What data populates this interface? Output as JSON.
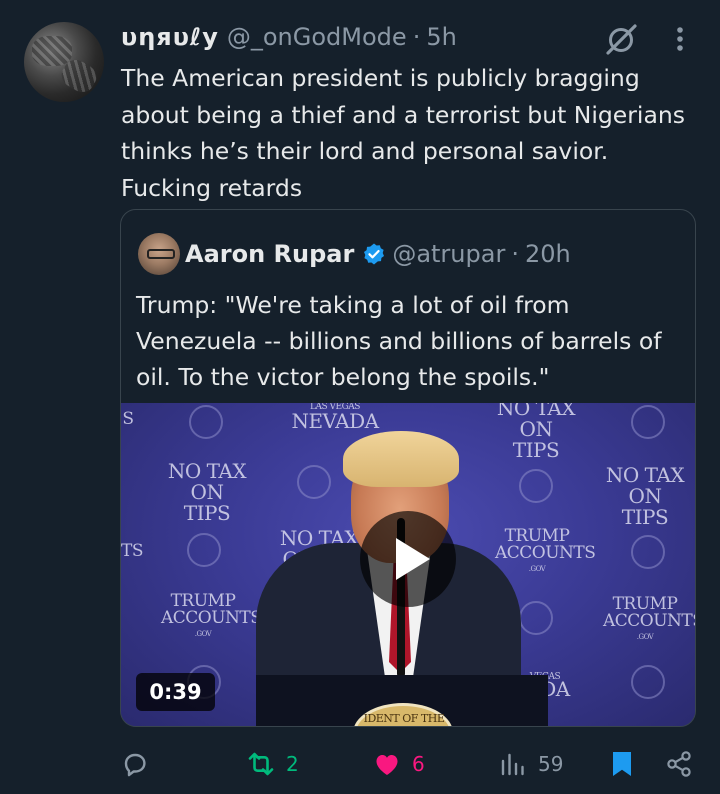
{
  "tweet": {
    "display_name": "υηяυℓу",
    "handle": "@_onGodMode",
    "separator": "·",
    "time": "5h",
    "text": "The American president is publicly bragging about being a thief and a terrorist but Nigerians thinks he’s their lord and personal savior. Fucking retards"
  },
  "quote": {
    "display_name": "Aaron Rupar",
    "verified": true,
    "handle": "@atrupar",
    "separator": "·",
    "time": "20h",
    "text": "Trump: \"We're taking a lot of oil from Venezuela -- billions and billions of barrels of oil. To the victor belong the spoils.\"",
    "video": {
      "duration": "0:39",
      "backdrop_text": {
        "nevada_top": "LAS VEGAS",
        "nevada": "NEVADA",
        "no_tax_1": "NO TAX",
        "on_tips_1": "ON TIPS",
        "no_tax_2": "NO TAX",
        "on_tips_2": "ON TIPS",
        "no_tax_3": "NO TAX",
        "on_tips_3": "ON TIPS",
        "no_tax_4": "NO TAX",
        "on_tips_4": "ON",
        "trump_1": "TRUMP",
        "accounts_1": "ACCOUNTS",
        "gov_1": ".GOV",
        "trump_2": "TRUMP",
        "accounts_2": "ACCOUNTS",
        "gov_2": ".GOV",
        "trump_3": "TRUMP",
        "accounts_3": "ACCOUNTS",
        "gov_3": ".GOV",
        "edge_s": "S",
        "edge_ts": "TS",
        "vegas_bottom": "VEGAS",
        "da_bottom": "DA",
        "seal_text": "IDENT OF THE U"
      }
    }
  },
  "actions": {
    "retweets": "2",
    "likes": "6",
    "views": "59"
  },
  "colors": {
    "background": "#15202b",
    "retweet": "#00ba7c",
    "like": "#f91880",
    "bookmark": "#1d9bf0",
    "muted": "#8b98a5"
  }
}
